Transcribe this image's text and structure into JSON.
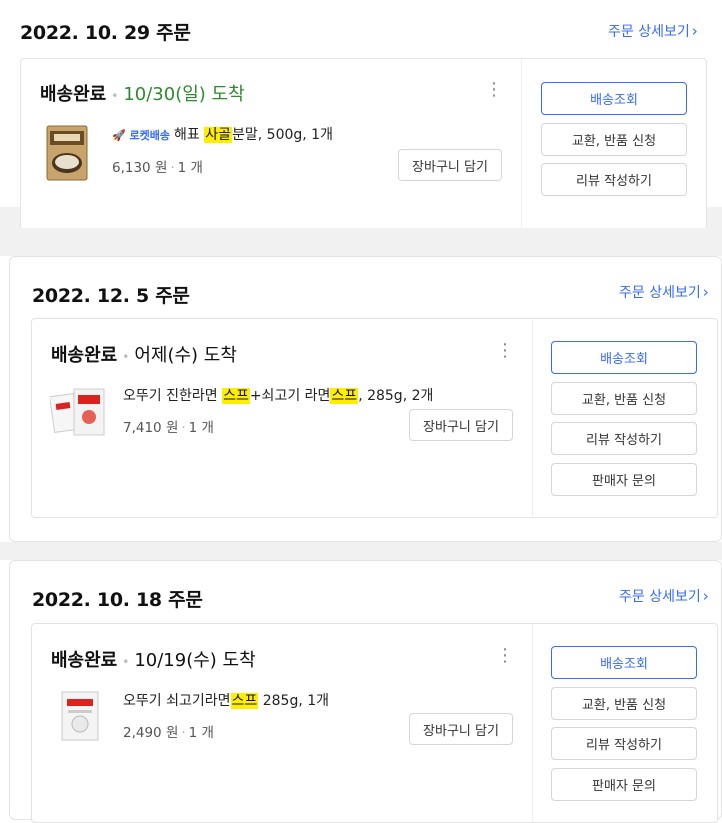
{
  "orders": [
    {
      "date": "2022. 10. 29 주문",
      "detail_link": "주문 상세보기",
      "status": "배송완료",
      "arrival": "10/30(일) 도착",
      "product_badge": "로켓배송",
      "product_name_pre": "해표 ",
      "product_name_highlight": "사골",
      "product_name_post": "분말, 500g, 1개",
      "price": "6,130 원",
      "qty": "1 개",
      "cart_button": "장바구니 담기",
      "actions": [
        "배송조회",
        "교환, 반품 신청",
        "리뷰 작성하기"
      ]
    },
    {
      "date": "2022. 12. 5 주문",
      "detail_link": "주문 상세보기",
      "status": "배송완료",
      "arrival": "어제(수) 도착",
      "product_name_a": "오뚜기 진한라면 ",
      "product_name_h1": "스프",
      "product_name_b": "+쇠고기 라면",
      "product_name_h2": "스프",
      "product_name_c": ", 285g, 2개",
      "price": "7,410 원",
      "qty": "1 개",
      "cart_button": "장바구니 담기",
      "actions": [
        "배송조회",
        "교환, 반품 신청",
        "리뷰 작성하기",
        "판매자 문의"
      ]
    },
    {
      "date": "2022. 10. 18 주문",
      "detail_link": "주문 상세보기",
      "status": "배송완료",
      "arrival": "10/19(수) 도착",
      "product_name_a": "오뚜기 쇠고기라면",
      "product_name_h1": "스프",
      "product_name_c": " 285g, 1개",
      "price": "2,490 원",
      "qty": "1 개",
      "cart_button": "장바구니 담기",
      "actions": [
        "배송조회",
        "교환, 반품 신청",
        "리뷰 작성하기",
        "판매자 문의"
      ]
    }
  ],
  "colors": {
    "accent": "#346aff",
    "arrival_green": "#2d8b2d",
    "highlight": "#ffee00"
  },
  "icons": {
    "chevron": "chevron-right-icon",
    "more": "more-vertical-icon"
  }
}
